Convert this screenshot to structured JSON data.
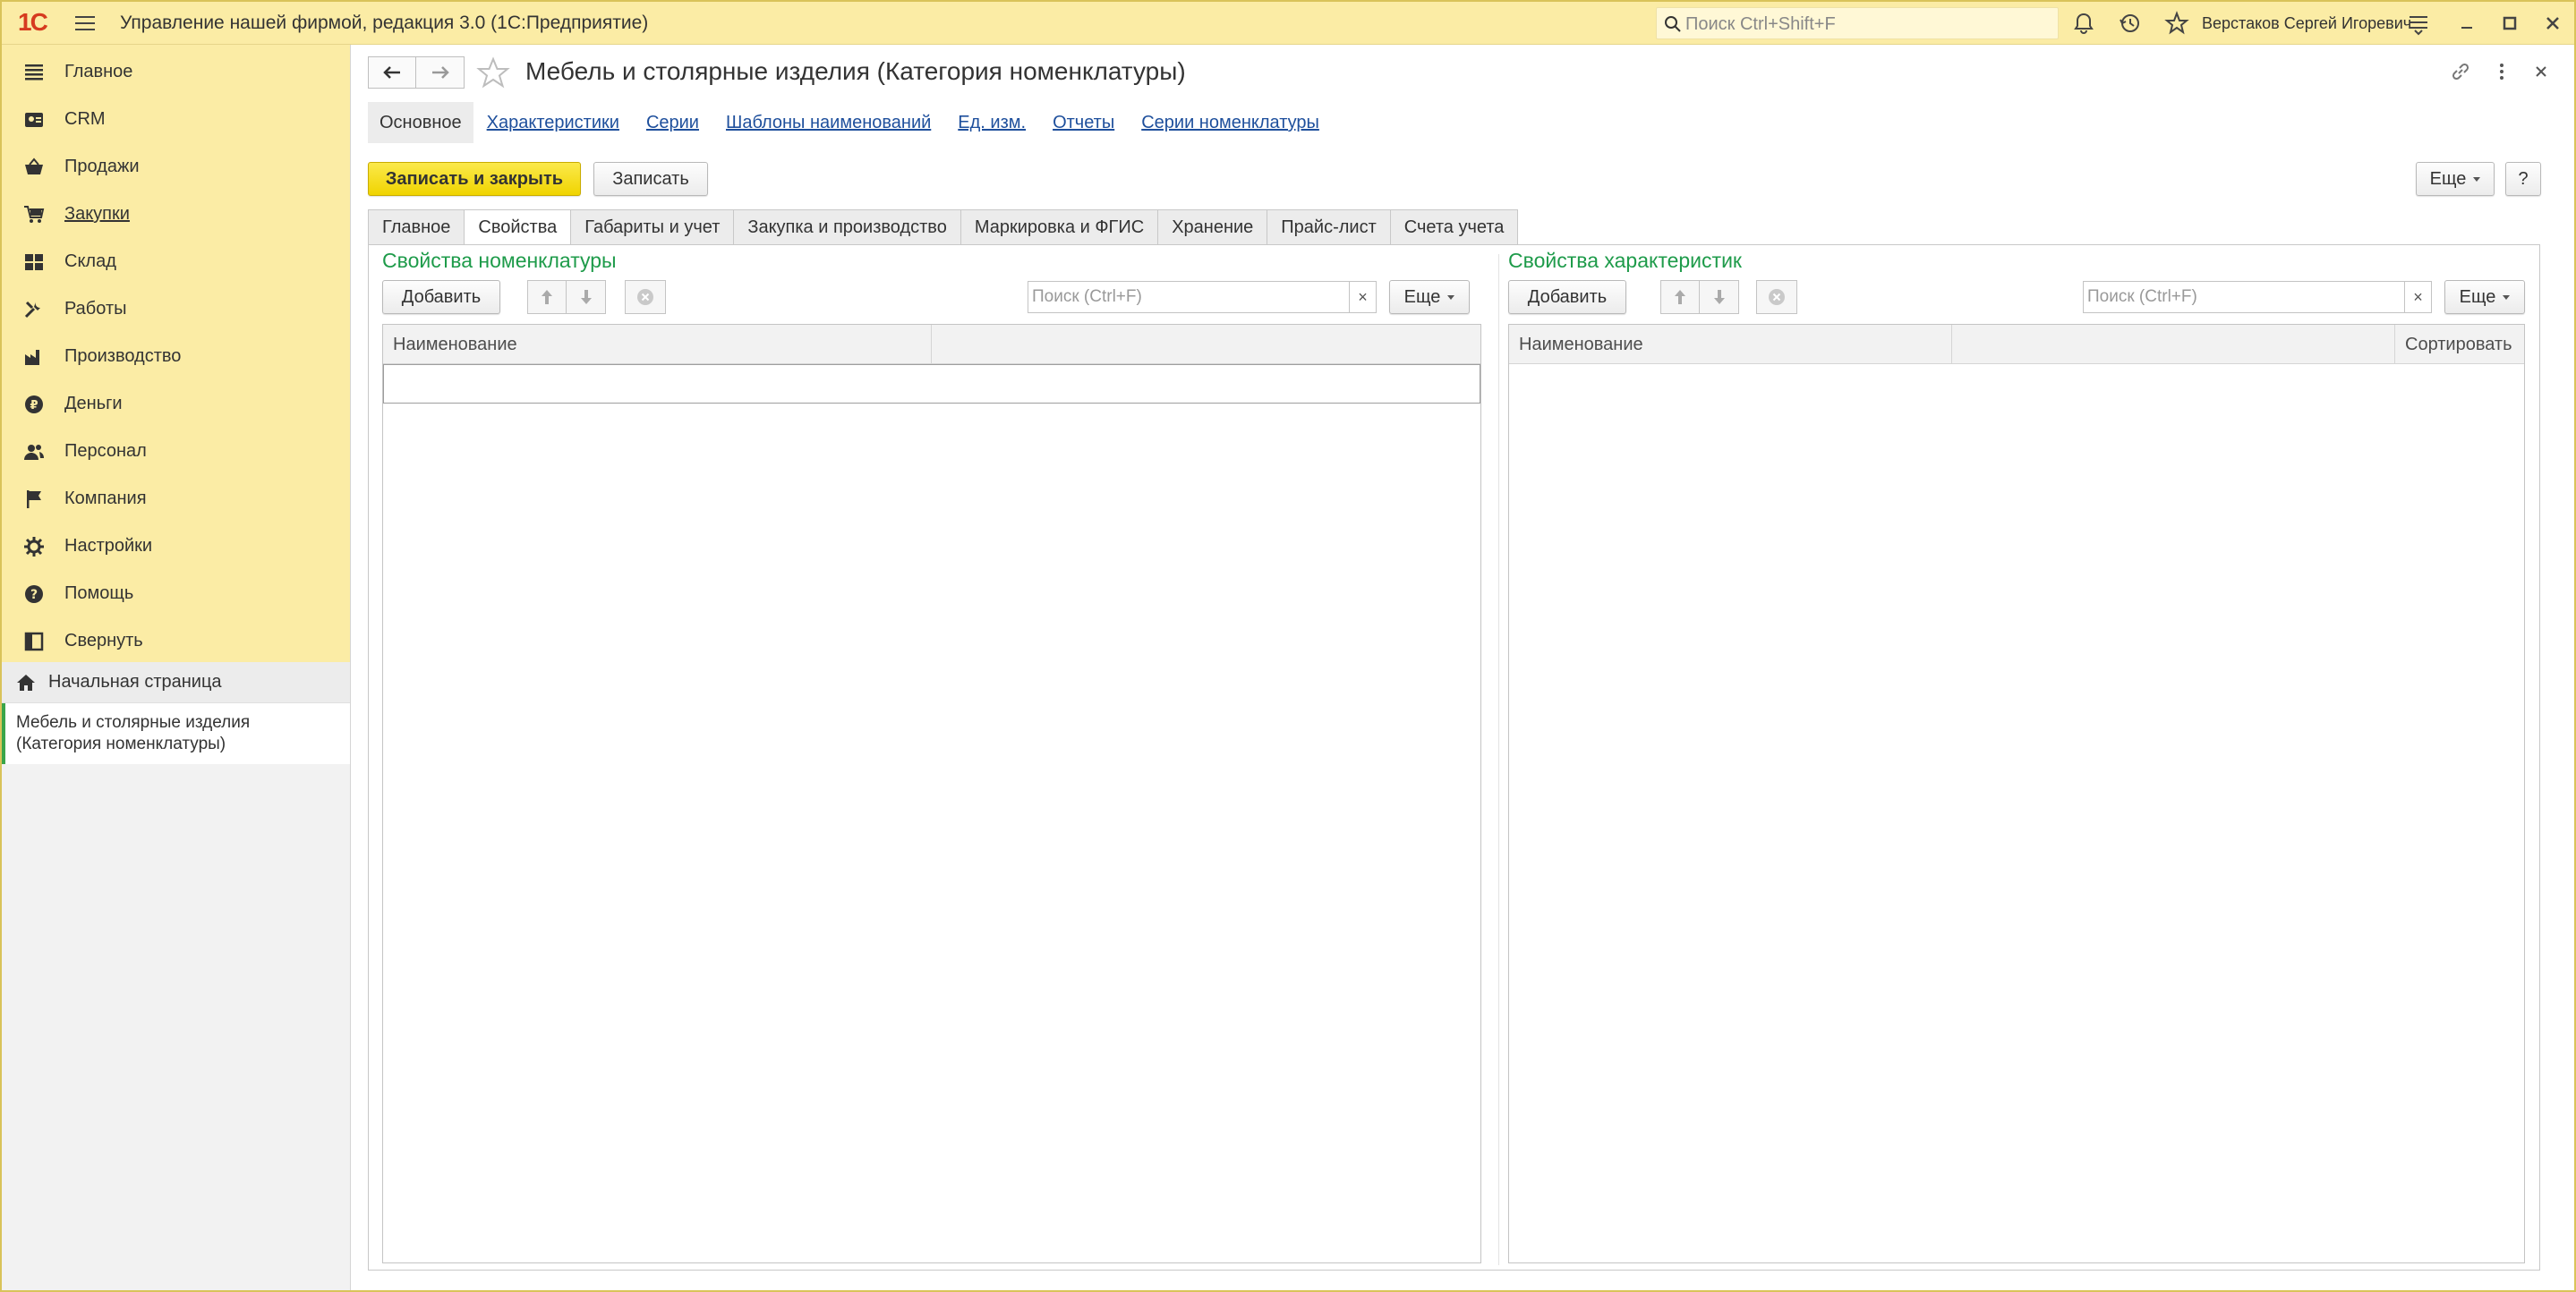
{
  "titlebar": {
    "app_title": "Управление нашей фирмой, редакция 3.0  (1С:Предприятие)",
    "logo_text": "1С",
    "search_placeholder": "Поиск Ctrl+Shift+F",
    "user_name": "Верстаков Сергей Игоревич"
  },
  "sidebar": {
    "sections": [
      {
        "label": "Главное",
        "icon": "menu-lines-icon"
      },
      {
        "label": "CRM",
        "icon": "contact-card-icon"
      },
      {
        "label": "Продажи",
        "icon": "basket-icon"
      },
      {
        "label": "Закупки",
        "icon": "cart-icon",
        "underlined": true
      },
      {
        "label": "Склад",
        "icon": "warehouse-icon"
      },
      {
        "label": "Работы",
        "icon": "tools-icon"
      },
      {
        "label": "Производство",
        "icon": "factory-icon"
      },
      {
        "label": "Деньги",
        "icon": "ruble-coin-icon"
      },
      {
        "label": "Персонал",
        "icon": "people-icon"
      },
      {
        "label": "Компания",
        "icon": "flag-icon"
      },
      {
        "label": "Настройки",
        "icon": "gear-icon"
      },
      {
        "label": "Помощь",
        "icon": "help-icon"
      },
      {
        "label": "Свернуть",
        "icon": "collapse-panel-icon"
      }
    ],
    "home_label": "Начальная страница",
    "opened_window": "Мебель и столярные изделия (Категория номенклатуры)"
  },
  "header": {
    "title": "Мебель и столярные изделия (Категория номенклатуры)"
  },
  "form_nav": [
    "Основное",
    "Характеристики",
    "Серии",
    "Шаблоны наименований",
    "Ед. изм.",
    "Отчеты",
    "Серии номенклатуры"
  ],
  "toolbar": {
    "save_close": "Записать и закрыть",
    "save": "Записать",
    "more": "Еще",
    "help": "?"
  },
  "tabs": [
    "Главное",
    "Свойства",
    "Габариты и учет",
    "Закупка и производство",
    "Маркировка и ФГИС",
    "Хранение",
    "Прайс-лист",
    "Счета учета"
  ],
  "active_tab": "Свойства",
  "left_pane": {
    "title": "Свойства номенклатуры",
    "add": "Добавить",
    "search_placeholder": "Поиск (Ctrl+F)",
    "clear": "×",
    "more": "Еще",
    "columns": [
      "Наименование",
      ""
    ]
  },
  "right_pane": {
    "title": "Свойства характеристик",
    "add": "Добавить",
    "search_placeholder": "Поиск (Ctrl+F)",
    "clear": "×",
    "more": "Еще",
    "columns": [
      "Наименование",
      "",
      "Сортировать"
    ]
  },
  "colors": {
    "titlebar_bg": "#fbeca5",
    "accent_green": "#1e9b4a",
    "link_blue": "#1e4f9c",
    "primary_button": "#f0d400",
    "logo_red": "#d63b1f"
  }
}
